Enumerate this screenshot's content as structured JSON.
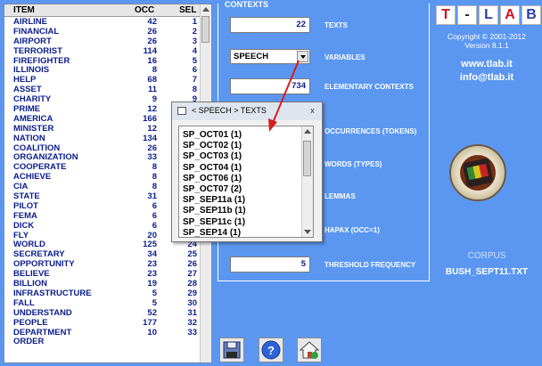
{
  "list": {
    "headers": {
      "item": "ITEM",
      "occ": "OCC",
      "sel": "SEL"
    },
    "rows": [
      {
        "item": "AIRLINE",
        "occ": "42",
        "sel": "1"
      },
      {
        "item": "FINANCIAL",
        "occ": "26",
        "sel": "2"
      },
      {
        "item": "AIRPORT",
        "occ": "26",
        "sel": "3"
      },
      {
        "item": "TERRORIST",
        "occ": "114",
        "sel": "4"
      },
      {
        "item": "FIREFIGHTER",
        "occ": "16",
        "sel": "5"
      },
      {
        "item": "ILLINOIS",
        "occ": "8",
        "sel": "6"
      },
      {
        "item": "HELP",
        "occ": "68",
        "sel": "7"
      },
      {
        "item": "ASSET",
        "occ": "11",
        "sel": "8"
      },
      {
        "item": "CHARITY",
        "occ": "9",
        "sel": "9"
      },
      {
        "item": "PRIME",
        "occ": "12",
        "sel": "10"
      },
      {
        "item": "AMERICA",
        "occ": "166",
        "sel": "11"
      },
      {
        "item": "MINISTER",
        "occ": "12",
        "sel": "12"
      },
      {
        "item": "NATION",
        "occ": "134",
        "sel": "13"
      },
      {
        "item": "COALITION",
        "occ": "26",
        "sel": "14"
      },
      {
        "item": "ORGANIZATION",
        "occ": "33",
        "sel": "15"
      },
      {
        "item": "COOPERATE",
        "occ": "8",
        "sel": "16"
      },
      {
        "item": "ACHIEVE",
        "occ": "8",
        "sel": "17"
      },
      {
        "item": "CIA",
        "occ": "8",
        "sel": "18"
      },
      {
        "item": "STATE",
        "occ": "31",
        "sel": "19"
      },
      {
        "item": "PILOT",
        "occ": "6",
        "sel": "20"
      },
      {
        "item": "FEMA",
        "occ": "6",
        "sel": "21"
      },
      {
        "item": "DICK",
        "occ": "6",
        "sel": "22"
      },
      {
        "item": "FLY",
        "occ": "20",
        "sel": "23"
      },
      {
        "item": "WORLD",
        "occ": "125",
        "sel": "24"
      },
      {
        "item": "SECRETARY",
        "occ": "34",
        "sel": "25"
      },
      {
        "item": "OPPORTUNITY",
        "occ": "23",
        "sel": "26"
      },
      {
        "item": "BELIEVE",
        "occ": "23",
        "sel": "27"
      },
      {
        "item": "BILLION",
        "occ": "19",
        "sel": "28"
      },
      {
        "item": "INFRASTRUCTURE",
        "occ": "5",
        "sel": "29"
      },
      {
        "item": "FALL",
        "occ": "5",
        "sel": "30"
      },
      {
        "item": "UNDERSTAND",
        "occ": "52",
        "sel": "31"
      },
      {
        "item": "PEOPLE",
        "occ": "177",
        "sel": "32"
      },
      {
        "item": "DEPARTMENT",
        "occ": "10",
        "sel": "33"
      },
      {
        "item": "ORDER",
        "occ": "",
        "sel": ""
      }
    ]
  },
  "contexts": {
    "title": "CONTEXTS",
    "texts_value": "22",
    "texts_label": "TEXTS",
    "variable_value": "SPEECH",
    "variables_label": "VARIABLES",
    "elementary_value": "734",
    "elementary_label": "ELEMENTARY CONTEXTS",
    "occurrences_label": "OCCURRENCES (TOKENS)",
    "words_label": "WORDS (TYPES)",
    "lemmas_label": "LEMMAS",
    "hapax_label": "HAPAX (OCC=1)",
    "threshold_value": "5",
    "threshold_label": "THRESHOLD FREQUENCY"
  },
  "popup": {
    "title": "< SPEECH > TEXTS",
    "close": "x",
    "items": [
      "SP_OCT01 (1)",
      "SP_OCT02 (1)",
      "SP_OCT03 (1)",
      "SP_OCT04 (1)",
      "SP_OCT06 (1)",
      "SP_OCT07 (2)",
      "SP_SEP11a (1)",
      "SP_SEP11b (1)",
      "SP_SEP11c (1)",
      "SP_SEP14 (1)"
    ]
  },
  "info": {
    "logo_letters": [
      "T",
      "-",
      "L",
      "A",
      "B"
    ],
    "logo_colors": [
      "#c8141e",
      "#222222",
      "#2a3fa8",
      "#c8141e",
      "#2a3fa8"
    ],
    "copyright": "Copyright © 2001-2012",
    "version": "Version 8.1.1",
    "website": "www.tlab.it",
    "email": "info@tlab.it",
    "corpus_label": "CORPUS",
    "corpus_file": "BUSH_SEPT11.TXT"
  },
  "toolbar": {
    "icons": [
      "save-icon",
      "help-icon",
      "home-icon"
    ]
  },
  "colors": {
    "background": "#5b97f1",
    "list_text": "#0b1c8c",
    "arrow": "#d21f1f",
    "corpus_label": "#cfe0ff"
  }
}
